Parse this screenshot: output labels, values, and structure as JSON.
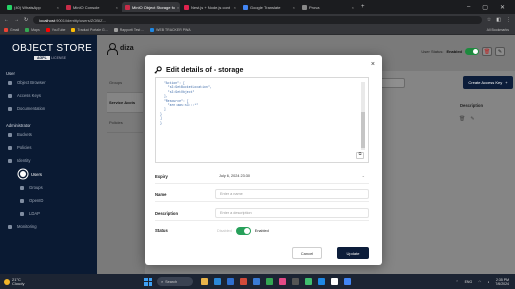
{
  "browser": {
    "tabs": [
      {
        "label": "(40) WhatsApp",
        "color": "#25d366",
        "active": false
      },
      {
        "label": "MinIO Console",
        "color": "#c72c48",
        "active": false
      },
      {
        "label": "MinIO Object Storage fo",
        "color": "#c72c48",
        "active": true
      },
      {
        "label": "Nest.js + Node.js cont",
        "color": "#e0234e",
        "active": false
      },
      {
        "label": "Google Translate",
        "color": "#4285f4",
        "active": false
      },
      {
        "label": "Prova",
        "color": "#888888",
        "active": false
      }
    ],
    "url_host": "localhost",
    "url_path": ":9001/identity/users/ZOBIZ...",
    "bookmarks": [
      {
        "label": "Gmail",
        "color": "#ea4335"
      },
      {
        "label": "Maps",
        "color": "#34a853"
      },
      {
        "label": "YouTube",
        "color": "#ff0000"
      },
      {
        "label": "Traduci Portale G...",
        "color": "#fbbc05"
      },
      {
        "label": "Rapporti Test ...",
        "color": "#9e9e9e"
      },
      {
        "label": "WEB TRACKER PWA",
        "color": "#1e88e5"
      }
    ],
    "bookmarks_all": "All Bookmarks"
  },
  "sidebar": {
    "brand": "OBJECT",
    "brand_suffix": "STORE",
    "license": "AGPL",
    "license_suffix": "LICENSE",
    "user_section": "User",
    "user_items": [
      "Object Browser",
      "Access Keys",
      "Documentation"
    ],
    "admin_section": "Administrator",
    "admin_items": [
      "Buckets",
      "Policies",
      "Identity"
    ],
    "identity_items": [
      "Users",
      "Groups",
      "OpenID",
      "LDAP"
    ],
    "more_item": "Monitoring"
  },
  "main": {
    "username": "diza",
    "user_status_label": "User Status:",
    "user_status_value": "Enabled",
    "left_tabs": [
      "Groups",
      "Service Accts",
      "Policies"
    ],
    "create_button": "Create Access Key",
    "create_plus": "+",
    "description_header": "Description"
  },
  "modal": {
    "title": "Edit details of - storage",
    "close": "×",
    "policy_lines": [
      "  \"Action\": [",
      "    \"s3:GetBucketLocation\",",
      "    \"s3:GetObject\"",
      "  ],",
      "  \"Resource\": [",
      "    \"arn:aws:s3:::*\"",
      "  ]",
      "}",
      "]",
      "}"
    ],
    "copy_icon": "⧉",
    "fields": {
      "expiry_label": "Expiry",
      "expiry_value": "July 6, 2024 23:30",
      "name_label": "Name",
      "name_placeholder": "Enter a name",
      "description_label": "Description",
      "description_placeholder": "Enter a description",
      "status_label": "Status",
      "status_off": "Disabled",
      "status_on": "Enabled"
    },
    "cancel": "Cancel",
    "update": "Update"
  },
  "taskbar": {
    "weather_temp": "21°C",
    "weather_desc": "Cloudy",
    "search": "Search",
    "app_colors": [
      "#e8b34a",
      "#2b88d8",
      "#2f6fd0",
      "#d04a3a",
      "#3a7bd5",
      "#34a853",
      "#e24a86",
      "#555555",
      "#3fbf6f",
      "#1e88e5",
      "#ffffff",
      "#4285f4"
    ],
    "lang": "ENG",
    "time": "2:35 PM",
    "date": "7/6/2024"
  }
}
